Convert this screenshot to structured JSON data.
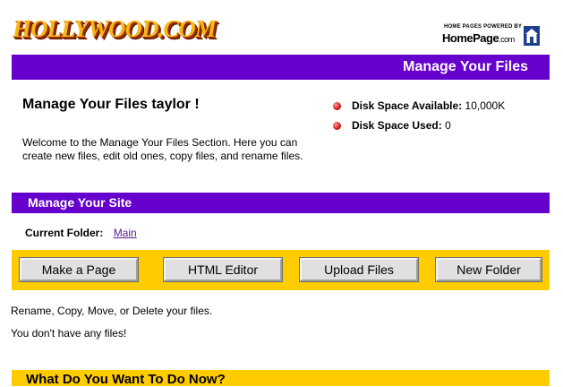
{
  "header": {
    "logo_text": "HOLLYWOOD.COM",
    "powered_by_small": "HOME PAGES POWERED BY",
    "powered_by_brand": "HomePage",
    "powered_by_suffix": ".com",
    "house_icon": "house-icon"
  },
  "top_bar": {
    "title": "Manage Your Files"
  },
  "intro": {
    "title": "Manage Your Files taylor !",
    "welcome": "Welcome to the Manage Your Files Section. Here you can create new files, edit old ones, copy files, and rename files."
  },
  "stats": [
    {
      "label": "Disk Space Available:",
      "value": "10,000K"
    },
    {
      "label": "Disk Space Used:",
      "value": "0"
    }
  ],
  "site_bar": {
    "title": "Manage Your Site"
  },
  "folder": {
    "label": "Current Folder:",
    "link": "Main"
  },
  "buttons": {
    "make_page": "Make a Page",
    "html_editor": "HTML Editor",
    "upload_files": "Upload Files",
    "new_folder": "New Folder"
  },
  "info": {
    "actions": "Rename, Copy, Move, or Delete your files.",
    "no_files": "You don't have any files!"
  },
  "bottom_bar": {
    "title": "What Do You Want To Do Now?"
  },
  "colors": {
    "purple": "#6600cc",
    "yellow": "#ffcc00",
    "logo_gold": "#f6b817",
    "bullet_red": "#d01818"
  }
}
